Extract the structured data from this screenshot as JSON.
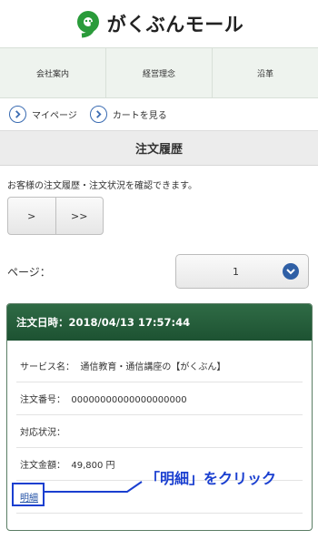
{
  "header": {
    "logo_text": "がくぶんモール",
    "logo_mark": "g-mark-icon"
  },
  "gnav": {
    "items": [
      "会社案内",
      "経営理念",
      "沿革"
    ]
  },
  "subnav": {
    "mypage": "マイページ",
    "cart": "カートを見る",
    "link_icon": "circle-arrow-icon"
  },
  "page_title": "注文履歴",
  "description": "お客様の注文履歴・注文状況を確認できます。",
  "pager": {
    "next": ">",
    "last": ">>"
  },
  "page_select": {
    "label": "ページ：",
    "value": "1"
  },
  "order": {
    "date_label": "注文日時：2018/04/13 17:57:44",
    "service": "サービス名：  通信教育・通信講座の【がくぶん】",
    "number": "注文番号：  00000000000000000000",
    "status": "対応状況：",
    "amount": "注文金額：  49,800 円",
    "detail_link": "明細"
  },
  "annotation": {
    "text": "「明細」をクリック",
    "color": "#1a3fd0"
  },
  "colors": {
    "brand_green": "#2a9b3a",
    "header_green": "#1d5232",
    "link_blue": "#1f4fa5"
  }
}
